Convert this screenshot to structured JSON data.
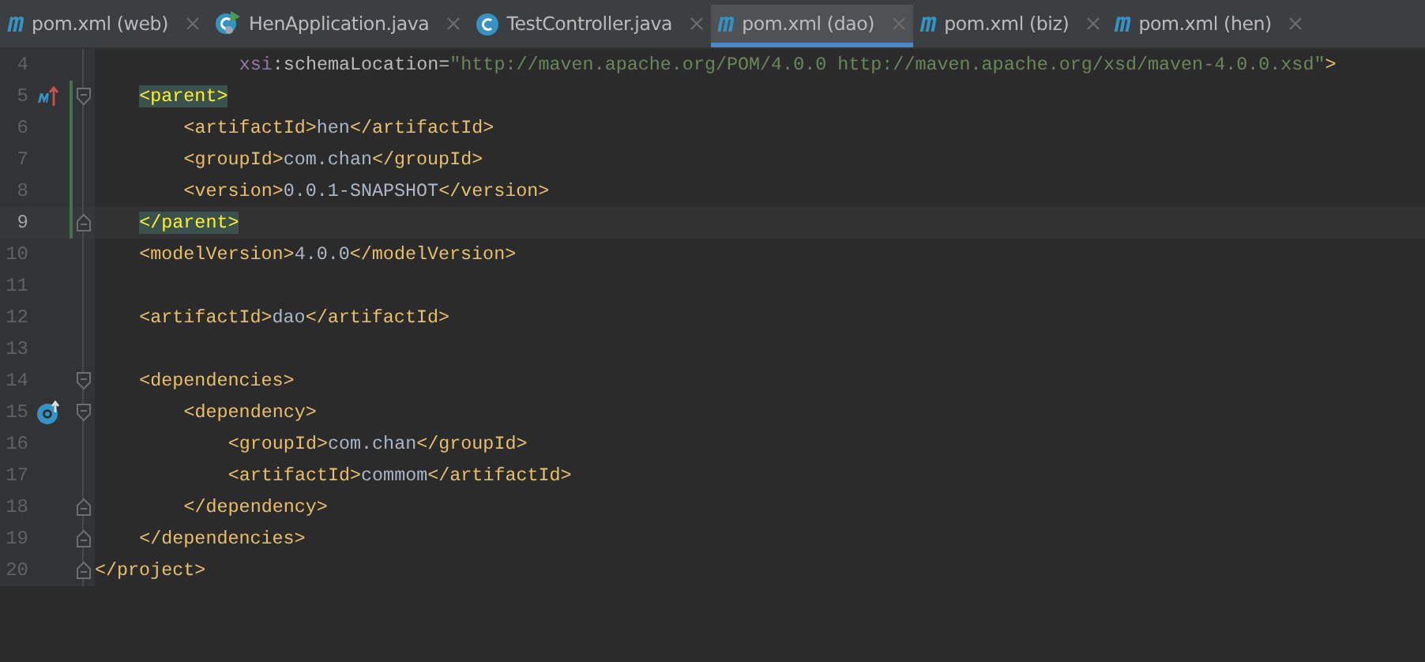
{
  "tabs": [
    {
      "label": "pom.xml (web)",
      "kind": "maven",
      "icon_text": "m",
      "selected": false
    },
    {
      "label": "HenApplication.java",
      "kind": "app",
      "selected": false
    },
    {
      "label": "TestController.java",
      "kind": "class",
      "selected": false
    },
    {
      "label": "pom.xml (dao)",
      "kind": "maven",
      "icon_text": "m",
      "selected": true
    },
    {
      "label": "pom.xml (biz)",
      "kind": "maven",
      "icon_text": "m",
      "selected": false
    },
    {
      "label": "pom.xml (hen)",
      "kind": "maven",
      "icon_text": "m",
      "selected": false
    }
  ],
  "lines": [
    {
      "number": "4",
      "kind": "continuation",
      "current": false,
      "changed": false,
      "tokens": [
        {
          "kind": "ns",
          "text": "xsi"
        },
        {
          "kind": "attr",
          "text": ":schemaLocation="
        },
        {
          "kind": "value",
          "text": "\"http://maven.apache.org/POM/4.0.0 http://maven.apache.org/xsd/maven-4.0.0.xsd\""
        },
        {
          "kind": "tag",
          "text": ">"
        }
      ]
    },
    {
      "number": "5",
      "current": false,
      "changed": true,
      "gutter": {
        "kind": "override"
      },
      "fold": {
        "kind": "start"
      },
      "tokens": [
        {
          "kind": "tag",
          "text": "<parent>",
          "highlight": true
        }
      ],
      "children": [
        {
          "number": "6",
          "current": false,
          "changed": true,
          "tokens": [
            {
              "kind": "tag",
              "text": "<artifactId>"
            },
            {
              "kind": "text",
              "text": "hen"
            },
            {
              "kind": "tag",
              "text": "</artifactId>"
            }
          ]
        },
        {
          "number": "7",
          "current": false,
          "changed": true,
          "tokens": [
            {
              "kind": "tag",
              "text": "<groupId>"
            },
            {
              "kind": "text",
              "text": "com.chan"
            },
            {
              "kind": "tag",
              "text": "</groupId>"
            }
          ]
        },
        {
          "number": "8",
          "current": false,
          "changed": true,
          "tokens": [
            {
              "kind": "tag",
              "text": "<version>"
            },
            {
              "kind": "text",
              "text": "0.0.1-SNAPSHOT"
            },
            {
              "kind": "tag",
              "text": "</version>"
            }
          ]
        }
      ]
    },
    {
      "number": "9",
      "current": true,
      "changed": true,
      "fold": {
        "kind": "end"
      },
      "tokens": [
        {
          "kind": "tag",
          "text": "</parent>",
          "highlight": true
        }
      ]
    },
    {
      "number": "10",
      "current": false,
      "changed": false,
      "tokens": [
        {
          "kind": "tag",
          "text": "<modelVersion>"
        },
        {
          "kind": "text",
          "text": "4.0.0"
        },
        {
          "kind": "tag",
          "text": "</modelVersion>"
        }
      ]
    },
    {
      "number": "11",
      "current": false,
      "changed": false
    },
    {
      "number": "12",
      "current": false,
      "changed": false,
      "tokens": [
        {
          "kind": "tag",
          "text": "<artifactId>"
        },
        {
          "kind": "text",
          "text": "dao"
        },
        {
          "kind": "tag",
          "text": "</artifactId>"
        }
      ]
    },
    {
      "number": "13",
      "current": false,
      "changed": false
    },
    {
      "number": "14",
      "current": false,
      "changed": false,
      "fold": {
        "kind": "start"
      },
      "tokens": [
        {
          "kind": "tag",
          "text": "<dependencies>"
        }
      ],
      "children": [
        {
          "number": "15",
          "current": false,
          "changed": false,
          "gutter": {
            "kind": "implemented"
          },
          "fold": {
            "kind": "start"
          },
          "tokens": [
            {
              "kind": "tag",
              "text": "<dependency>"
            }
          ],
          "children": [
            {
              "number": "16",
              "current": false,
              "changed": false,
              "tokens": [
                {
                  "kind": "tag",
                  "text": "<groupId>"
                },
                {
                  "kind": "text",
                  "text": "com.chan"
                },
                {
                  "kind": "tag",
                  "text": "</groupId>"
                }
              ]
            },
            {
              "number": "17",
              "current": false,
              "changed": false,
              "tokens": [
                {
                  "kind": "tag",
                  "text": "<artifactId>"
                },
                {
                  "kind": "text",
                  "text": "commom"
                },
                {
                  "kind": "tag",
                  "text": "</artifactId>"
                }
              ]
            }
          ]
        },
        {
          "number": "18",
          "current": false,
          "changed": false,
          "fold": {
            "kind": "end"
          },
          "tokens": [
            {
              "kind": "tag",
              "text": "</dependency>"
            }
          ]
        }
      ]
    },
    {
      "number": "19",
      "current": false,
      "changed": false,
      "fold": {
        "kind": "end"
      },
      "tokens": [
        {
          "kind": "tag",
          "text": "</dependencies>"
        }
      ]
    },
    {
      "number": "20",
      "kind": "root",
      "current": false,
      "changed": false,
      "fold": {
        "kind": "end"
      },
      "tokens": [
        {
          "kind": "tag",
          "text": "</project>"
        }
      ]
    }
  ]
}
